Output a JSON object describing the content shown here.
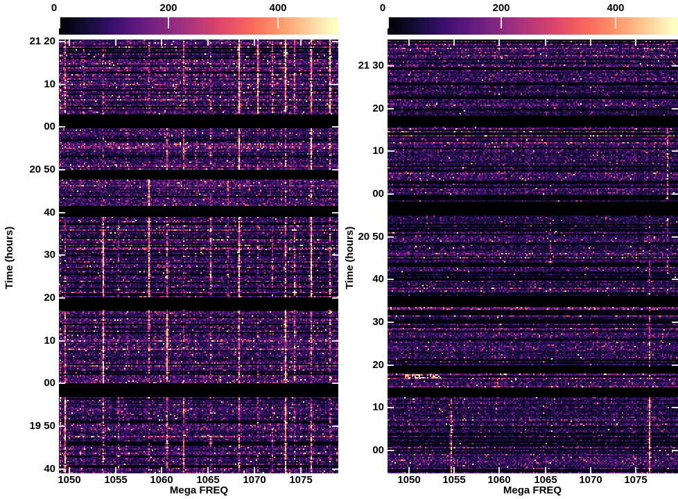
{
  "figure": {
    "x_axis_title": "Mega FREQ",
    "y_axis_title": "Time (hours)",
    "background_color": "#ffffff",
    "text_color": "#000000",
    "tick_mark_color": "#e0e0e0",
    "colormap": "magma",
    "colormap_hex_stops": [
      "#000004",
      "#140e36",
      "#3b0f70",
      "#651a80",
      "#8c2981",
      "#b73779",
      "#de4968",
      "#f7685c",
      "#fe9467",
      "#fec692",
      "#fcfdbf"
    ]
  },
  "chart_data": [
    {
      "type": "heatmap",
      "panel": "left",
      "xlabel": "Mega FREQ",
      "ylabel": "Time (hours)",
      "colormap": "magma",
      "x_tick_labels": [
        "1050",
        "1055",
        "1060",
        "1065",
        "1070",
        "1075"
      ],
      "y_tick_labels": [
        "21 20",
        "10",
        "00",
        "20 50",
        "40",
        "30",
        "20",
        "10",
        "00",
        "19 50",
        "40"
      ],
      "freq_range_mhz": [
        1048.9,
        1079.1
      ],
      "time_range": [
        "19:39",
        "21:21"
      ],
      "colorbar": {
        "tick_labels": [
          "0",
          "200",
          "400"
        ],
        "tick_values": [
          0,
          200,
          400
        ],
        "vmax": 510,
        "bar_max": 530
      },
      "gaps_frac": [
        [
          0.1725,
          0.2013
        ],
        [
          0.2972,
          0.3211
        ],
        [
          0.3802,
          0.4089
        ],
        [
          0.5911,
          0.623
        ],
        [
          0.7923,
          0.8227
        ]
      ],
      "gap_times": [
        "21:00-21:03",
        "20:48-20:51",
        "20:39-20:42",
        "20:17-20:21",
        "19:57-20:00"
      ],
      "rfi_lines": [
        {
          "freq": 1049.0,
          "strength": [
            1,
            1,
            0,
            1,
            1,
            2
          ]
        },
        {
          "freq": 1049.5,
          "strength": [
            2,
            0,
            0,
            1,
            2,
            3
          ]
        },
        {
          "freq": 1051.5,
          "strength": [
            1,
            0,
            0,
            0,
            0,
            0
          ]
        },
        {
          "freq": 1053.6,
          "strength": [
            1,
            1,
            0,
            3,
            3,
            2
          ]
        },
        {
          "freq": 1055.3,
          "strength": [
            0,
            0,
            0,
            1,
            0,
            1
          ]
        },
        {
          "freq": 1058.6,
          "strength": [
            1,
            0,
            3,
            3,
            2,
            1
          ]
        },
        {
          "freq": 1060.5,
          "strength": [
            0,
            2,
            0,
            2,
            3,
            2
          ]
        },
        {
          "freq": 1062.3,
          "strength": [
            2,
            2,
            0,
            1,
            1,
            2
          ]
        },
        {
          "freq": 1065.2,
          "strength": [
            1,
            1,
            1,
            2,
            1,
            1
          ]
        },
        {
          "freq": 1067.1,
          "strength": [
            0,
            0,
            2,
            1,
            0,
            0
          ]
        },
        {
          "freq": 1068.3,
          "strength": [
            3,
            3,
            0,
            3,
            2,
            2
          ]
        },
        {
          "freq": 1070.3,
          "strength": [
            3,
            1,
            0,
            1,
            1,
            1
          ]
        },
        {
          "freq": 1071.9,
          "strength": [
            2,
            0,
            0,
            1,
            0,
            1
          ]
        },
        {
          "freq": 1073.3,
          "strength": [
            3,
            2,
            1,
            2,
            3,
            3
          ]
        },
        {
          "freq": 1074.3,
          "strength": [
            2,
            0,
            0,
            2,
            2,
            1
          ]
        },
        {
          "freq": 1076.1,
          "strength": [
            3,
            3,
            2,
            3,
            2,
            2
          ]
        },
        {
          "freq": 1078.1,
          "strength": [
            3,
            2,
            0,
            2,
            2,
            1
          ]
        }
      ],
      "streaks": [],
      "noise": {
        "gain": 1.0,
        "speckle": 0.018,
        "seed": 1337
      }
    },
    {
      "type": "heatmap",
      "panel": "right",
      "xlabel": "Mega FREQ",
      "ylabel": "Time (hours)",
      "colormap": "magma",
      "x_tick_labels": [
        "1050",
        "1055",
        "1060",
        "1065",
        "1070",
        "1075"
      ],
      "y_tick_labels": [
        "21 30",
        "20",
        "10",
        "00",
        "20 50",
        "40",
        "30",
        "20",
        "10",
        "00"
      ],
      "freq_range_mhz": [
        1047.6,
        1079.7
      ],
      "time_range": [
        "19:55",
        "21:36"
      ],
      "colorbar": {
        "tick_labels": [
          "0",
          "200",
          "400"
        ],
        "tick_values": [
          0,
          200,
          400
        ],
        "vmax": 510,
        "bar_max": 530
      },
      "gaps_frac": [
        [
          0.1757,
          0.1997
        ],
        [
          0.372,
          0.404
        ],
        [
          0.588,
          0.615
        ],
        [
          0.752,
          0.768
        ],
        [
          0.799,
          0.823
        ]
      ],
      "gap_times": [
        "21:16-21:18",
        "20:55-20:58",
        "20:34-20:36",
        "20:18-20:20",
        "20:13-20:15"
      ],
      "rfi_lines": [
        {
          "freq": 1054.6,
          "strength": [
            0,
            0,
            0,
            0,
            0,
            2
          ]
        },
        {
          "freq": 1065.5,
          "strength": [
            0,
            0,
            1,
            0,
            0,
            0
          ]
        },
        {
          "freq": 1076.5,
          "strength": [
            0,
            0,
            1,
            2,
            1,
            3
          ]
        },
        {
          "freq": 1078.5,
          "strength": [
            0,
            2,
            1,
            0,
            0,
            0
          ]
        }
      ],
      "streaks": [
        {
          "y_frac": [
            0.772,
            0.781
          ],
          "freq_range": [
            1049.5,
            1053.5
          ],
          "strength": 3
        }
      ],
      "noise": {
        "gain": 0.85,
        "speckle": 0.012,
        "seed": 2024
      }
    }
  ]
}
